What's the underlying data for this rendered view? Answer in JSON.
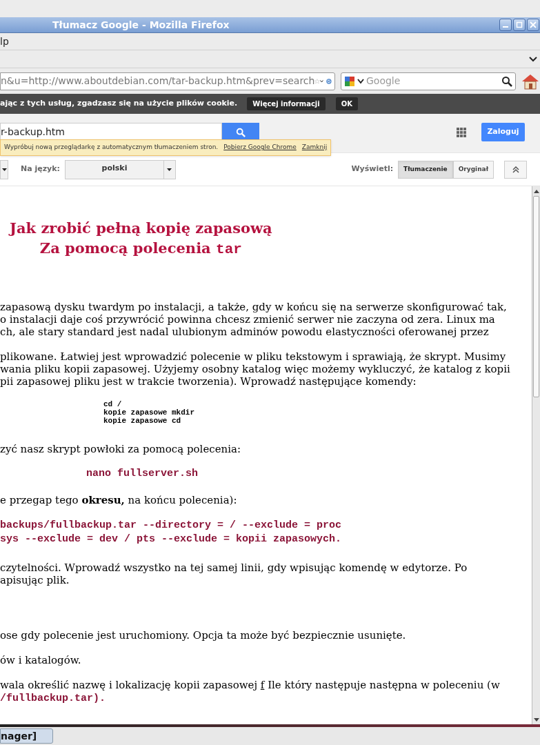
{
  "window": {
    "title": "Tłumacz Google - Mozilla Firefox"
  },
  "menu": {
    "label": "lp"
  },
  "nav": {
    "url": "n&u=http://www.aboutdebian.com/tar-backup.htm&prev=search",
    "search_placeholder": "Google"
  },
  "cookie_bar": {
    "text": "ając z tych usług, zgadzasz się na użycie plików cookie.",
    "buttons": [
      "Więcej informacji",
      "OK"
    ]
  },
  "google_bar": {
    "query": "r-backup.htm",
    "login": "Zaloguj"
  },
  "promo": {
    "text": "Wypróbuj nową przeglądarkę z automatycznym tłumaczeniem stron.",
    "links": [
      "Pobierz Google Chrome",
      "Zamknij"
    ]
  },
  "lang_row": {
    "target_label": "Na język:",
    "target_value": "polski",
    "view_label": "Wyświetl:",
    "views": [
      {
        "label": "Tłumaczenie",
        "selected": true
      },
      {
        "label": "Oryginał",
        "selected": false
      }
    ]
  },
  "article": [
    {
      "kind": "heading",
      "lines": [
        [
          {
            "t": "Jak zrobić pełną kopię zapasową"
          }
        ],
        [
          {
            "t": "Za pomocą polecenia "
          },
          {
            "t": "tar",
            "code": true
          }
        ]
      ]
    },
    {
      "kind": "para",
      "lines": [
        "zapasową dysku twardym po instalacji, a także, gdy w końcu się na serwerze skonfigurować tak,",
        "o instalacji daje coś przywrócić powinna chcesz zmienić serwer nie zaczyna od zera. Linux ma",
        "ch, ale stary standard jest nadal ulubionym adminów powodu elastyczności oferowanej przez"
      ]
    },
    {
      "kind": "para",
      "lines": [
        "plikowane. Łatwiej jest wprowadzić polecenie w pliku tekstowym i sprawiają, że skrypt. Musimy",
        "wania pliku kopii zapasowej. Użyjemy osobny katalog więc możemy wykluczyć, że katalog z kopii",
        "pii zapasowej pliku jest w trakcie tworzenia). Wprowadź następujące komendy:"
      ]
    },
    {
      "kind": "commands",
      "lines": [
        "cd /",
        "kopie zapasowe mkdir",
        "kopie zapasowe cd"
      ]
    },
    {
      "kind": "para",
      "lines": [
        "zyć nasz skrypt powłoki za pomocą polecenia:"
      ]
    },
    {
      "kind": "command",
      "lines": [
        "nano fullserver.sh"
      ]
    },
    {
      "kind": "para",
      "lines": [
        "e przegap tego **okresu,** na końcu polecenia):"
      ]
    },
    {
      "kind": "longcommand",
      "lines": [
        "backups/fullbackup.tar --directory = / --exclude = proc",
        "sys --exclude = dev / pts --exclude = kopii zapasowych."
      ]
    },
    {
      "kind": "para",
      "lines": [
        "czytelności. Wprowadź wszystko na tej samej linii, gdy wpisując komendę w edytorze. Po",
        "apisując plik."
      ]
    },
    {
      "kind": "spacer"
    },
    {
      "kind": "para",
      "lines": [
        "ose gdy polecenie jest uruchomiony. Opcja ta może być bezpiecznie usunięte."
      ]
    },
    {
      "kind": "para",
      "lines": [
        "ów i katalogów."
      ]
    },
    {
      "kind": "mixed",
      "lines": [
        [
          {
            "t": "wala określić nazwę i lokalizację kopii zapasowej "
          },
          {
            "t": "f",
            "u": true
          },
          {
            "t": " Ile który następuje następna w poleceniu (w"
          }
        ],
        [
          {
            "t": "/fullbackup.tar).",
            "code": true
          }
        ]
      ]
    }
  ],
  "taskbar": {
    "item": "nager]"
  }
}
